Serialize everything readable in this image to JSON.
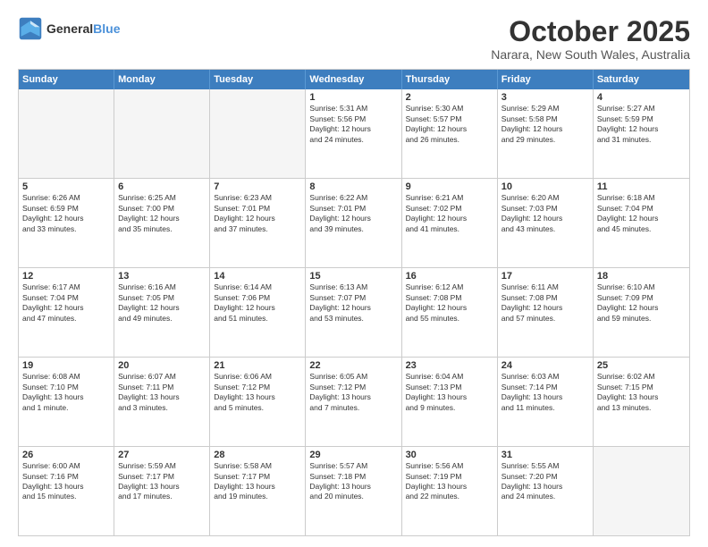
{
  "header": {
    "logo_general": "General",
    "logo_blue": "Blue",
    "month": "October 2025",
    "location": "Narara, New South Wales, Australia"
  },
  "weekdays": [
    "Sunday",
    "Monday",
    "Tuesday",
    "Wednesday",
    "Thursday",
    "Friday",
    "Saturday"
  ],
  "rows": [
    [
      {
        "day": "",
        "empty": true
      },
      {
        "day": "",
        "empty": true
      },
      {
        "day": "",
        "empty": true
      },
      {
        "day": "1",
        "line1": "Sunrise: 5:31 AM",
        "line2": "Sunset: 5:56 PM",
        "line3": "Daylight: 12 hours",
        "line4": "and 24 minutes."
      },
      {
        "day": "2",
        "line1": "Sunrise: 5:30 AM",
        "line2": "Sunset: 5:57 PM",
        "line3": "Daylight: 12 hours",
        "line4": "and 26 minutes."
      },
      {
        "day": "3",
        "line1": "Sunrise: 5:29 AM",
        "line2": "Sunset: 5:58 PM",
        "line3": "Daylight: 12 hours",
        "line4": "and 29 minutes."
      },
      {
        "day": "4",
        "line1": "Sunrise: 5:27 AM",
        "line2": "Sunset: 5:59 PM",
        "line3": "Daylight: 12 hours",
        "line4": "and 31 minutes."
      }
    ],
    [
      {
        "day": "5",
        "line1": "Sunrise: 6:26 AM",
        "line2": "Sunset: 6:59 PM",
        "line3": "Daylight: 12 hours",
        "line4": "and 33 minutes."
      },
      {
        "day": "6",
        "line1": "Sunrise: 6:25 AM",
        "line2": "Sunset: 7:00 PM",
        "line3": "Daylight: 12 hours",
        "line4": "and 35 minutes."
      },
      {
        "day": "7",
        "line1": "Sunrise: 6:23 AM",
        "line2": "Sunset: 7:01 PM",
        "line3": "Daylight: 12 hours",
        "line4": "and 37 minutes."
      },
      {
        "day": "8",
        "line1": "Sunrise: 6:22 AM",
        "line2": "Sunset: 7:01 PM",
        "line3": "Daylight: 12 hours",
        "line4": "and 39 minutes."
      },
      {
        "day": "9",
        "line1": "Sunrise: 6:21 AM",
        "line2": "Sunset: 7:02 PM",
        "line3": "Daylight: 12 hours",
        "line4": "and 41 minutes."
      },
      {
        "day": "10",
        "line1": "Sunrise: 6:20 AM",
        "line2": "Sunset: 7:03 PM",
        "line3": "Daylight: 12 hours",
        "line4": "and 43 minutes."
      },
      {
        "day": "11",
        "line1": "Sunrise: 6:18 AM",
        "line2": "Sunset: 7:04 PM",
        "line3": "Daylight: 12 hours",
        "line4": "and 45 minutes."
      }
    ],
    [
      {
        "day": "12",
        "line1": "Sunrise: 6:17 AM",
        "line2": "Sunset: 7:04 PM",
        "line3": "Daylight: 12 hours",
        "line4": "and 47 minutes."
      },
      {
        "day": "13",
        "line1": "Sunrise: 6:16 AM",
        "line2": "Sunset: 7:05 PM",
        "line3": "Daylight: 12 hours",
        "line4": "and 49 minutes."
      },
      {
        "day": "14",
        "line1": "Sunrise: 6:14 AM",
        "line2": "Sunset: 7:06 PM",
        "line3": "Daylight: 12 hours",
        "line4": "and 51 minutes."
      },
      {
        "day": "15",
        "line1": "Sunrise: 6:13 AM",
        "line2": "Sunset: 7:07 PM",
        "line3": "Daylight: 12 hours",
        "line4": "and 53 minutes."
      },
      {
        "day": "16",
        "line1": "Sunrise: 6:12 AM",
        "line2": "Sunset: 7:08 PM",
        "line3": "Daylight: 12 hours",
        "line4": "and 55 minutes."
      },
      {
        "day": "17",
        "line1": "Sunrise: 6:11 AM",
        "line2": "Sunset: 7:08 PM",
        "line3": "Daylight: 12 hours",
        "line4": "and 57 minutes."
      },
      {
        "day": "18",
        "line1": "Sunrise: 6:10 AM",
        "line2": "Sunset: 7:09 PM",
        "line3": "Daylight: 12 hours",
        "line4": "and 59 minutes."
      }
    ],
    [
      {
        "day": "19",
        "line1": "Sunrise: 6:08 AM",
        "line2": "Sunset: 7:10 PM",
        "line3": "Daylight: 13 hours",
        "line4": "and 1 minute."
      },
      {
        "day": "20",
        "line1": "Sunrise: 6:07 AM",
        "line2": "Sunset: 7:11 PM",
        "line3": "Daylight: 13 hours",
        "line4": "and 3 minutes."
      },
      {
        "day": "21",
        "line1": "Sunrise: 6:06 AM",
        "line2": "Sunset: 7:12 PM",
        "line3": "Daylight: 13 hours",
        "line4": "and 5 minutes."
      },
      {
        "day": "22",
        "line1": "Sunrise: 6:05 AM",
        "line2": "Sunset: 7:12 PM",
        "line3": "Daylight: 13 hours",
        "line4": "and 7 minutes."
      },
      {
        "day": "23",
        "line1": "Sunrise: 6:04 AM",
        "line2": "Sunset: 7:13 PM",
        "line3": "Daylight: 13 hours",
        "line4": "and 9 minutes."
      },
      {
        "day": "24",
        "line1": "Sunrise: 6:03 AM",
        "line2": "Sunset: 7:14 PM",
        "line3": "Daylight: 13 hours",
        "line4": "and 11 minutes."
      },
      {
        "day": "25",
        "line1": "Sunrise: 6:02 AM",
        "line2": "Sunset: 7:15 PM",
        "line3": "Daylight: 13 hours",
        "line4": "and 13 minutes."
      }
    ],
    [
      {
        "day": "26",
        "line1": "Sunrise: 6:00 AM",
        "line2": "Sunset: 7:16 PM",
        "line3": "Daylight: 13 hours",
        "line4": "and 15 minutes."
      },
      {
        "day": "27",
        "line1": "Sunrise: 5:59 AM",
        "line2": "Sunset: 7:17 PM",
        "line3": "Daylight: 13 hours",
        "line4": "and 17 minutes."
      },
      {
        "day": "28",
        "line1": "Sunrise: 5:58 AM",
        "line2": "Sunset: 7:17 PM",
        "line3": "Daylight: 13 hours",
        "line4": "and 19 minutes."
      },
      {
        "day": "29",
        "line1": "Sunrise: 5:57 AM",
        "line2": "Sunset: 7:18 PM",
        "line3": "Daylight: 13 hours",
        "line4": "and 20 minutes."
      },
      {
        "day": "30",
        "line1": "Sunrise: 5:56 AM",
        "line2": "Sunset: 7:19 PM",
        "line3": "Daylight: 13 hours",
        "line4": "and 22 minutes."
      },
      {
        "day": "31",
        "line1": "Sunrise: 5:55 AM",
        "line2": "Sunset: 7:20 PM",
        "line3": "Daylight: 13 hours",
        "line4": "and 24 minutes."
      },
      {
        "day": "",
        "empty": true
      }
    ]
  ]
}
